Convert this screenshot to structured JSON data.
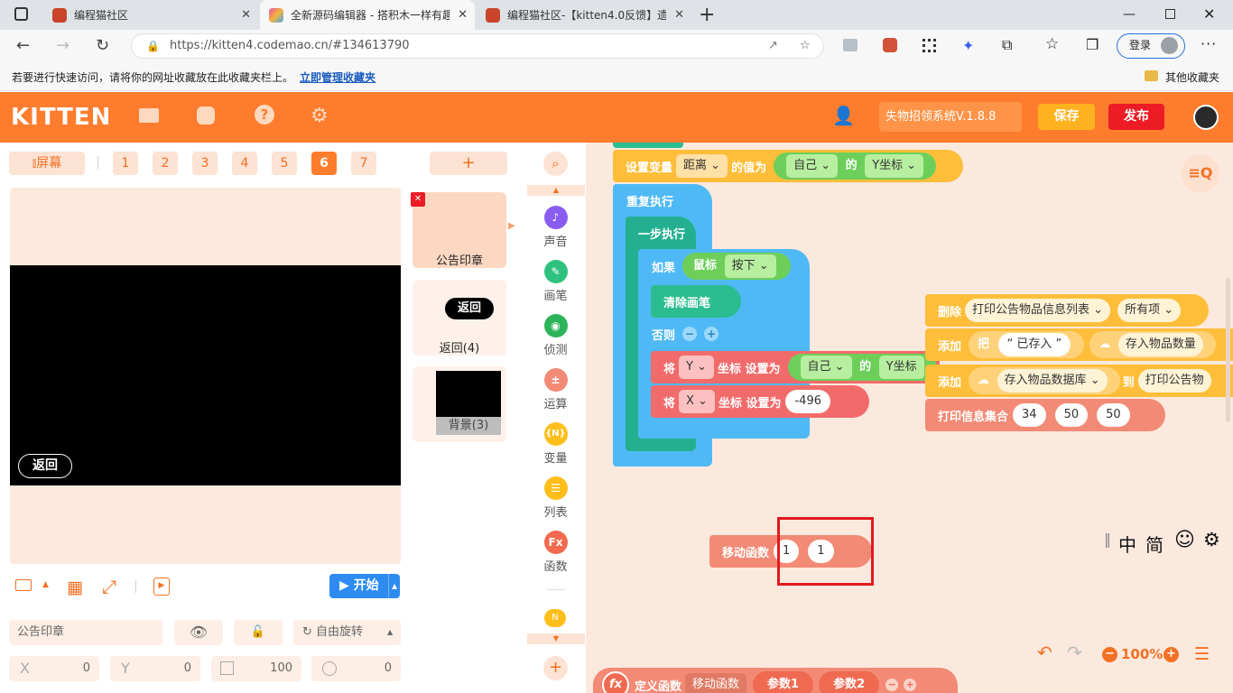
{
  "browser": {
    "tabs": [
      {
        "title": "编程猫社区",
        "active": false
      },
      {
        "title": "全新源码编辑器 - 搭积木一样有趣",
        "active": true
      },
      {
        "title": "编程猫社区-【kitten4.0反馈】遗",
        "active": false
      }
    ],
    "url": "https://kitten4.codemao.cn/#134613790",
    "login_label": "登录",
    "bookmark_tip": "若要进行快速访问，请将你的网址收藏放在此收藏夹栏上。",
    "bookmark_link": "立即管理收藏夹",
    "other_favorites": "其他收藏夹"
  },
  "app": {
    "logo": "KITTEN",
    "project_name": "失物招领系统V.1.8.8",
    "save_label": "保存",
    "publish_label": "发布",
    "accent": "#fe7c2d"
  },
  "screens": {
    "screen_toggle": "屏幕",
    "numbers": [
      "1",
      "2",
      "3",
      "4",
      "5",
      "6",
      "7"
    ],
    "active": "6"
  },
  "stage": {
    "back_label": "返回",
    "start_label": "开始"
  },
  "properties": {
    "name": "公告印章",
    "rotation": "自由旋转",
    "x_label": "X",
    "x_value": "0",
    "y_label": "Y",
    "y_value": "0",
    "size_value": "100",
    "direction_value": "0"
  },
  "sprites": {
    "add_label": "+",
    "items": [
      {
        "name": "公告印章"
      },
      {
        "name": "返回(4)",
        "thumb_text": "返回"
      },
      {
        "name": "背景(3)"
      }
    ]
  },
  "categories": [
    {
      "label": "声音",
      "color": "#8a5cf0",
      "icon": "music-icon"
    },
    {
      "label": "画笔",
      "color": "#2ec27e",
      "icon": "pen-icon"
    },
    {
      "label": "侦测",
      "color": "#2db35a",
      "icon": "sensing-icon"
    },
    {
      "label": "运算",
      "color": "#f38a75",
      "icon": "operator-icon"
    },
    {
      "label": "变量",
      "color": "#ffbe1a",
      "icon": "variable-icon",
      "glyph": "{N}"
    },
    {
      "label": "列表",
      "color": "#ffbe1a",
      "icon": "list-icon"
    },
    {
      "label": "函数",
      "color": "#f2694f",
      "icon": "function-icon",
      "glyph": "Fx"
    }
  ],
  "blocks": {
    "set_var": {
      "label": "设置变量",
      "var": "距离",
      "mid": "的值为",
      "obj": "自己",
      "of": "的",
      "attr": "Y坐标"
    },
    "repeat": "重复执行",
    "step": "一步执行",
    "if": {
      "label": "如果",
      "sensor": "鼠标",
      "state": "按下"
    },
    "clear": "清除画笔",
    "else": "否则",
    "set_y": {
      "label": "将",
      "axis": "Y",
      "mid": "坐标 设置为",
      "obj": "自己",
      "of": "的",
      "attr": "Y坐标"
    },
    "set_x": {
      "label": "将",
      "axis": "X",
      "mid": "坐标 设置为",
      "value": "-496"
    },
    "delete": {
      "label": "删除",
      "list": "打印公告物品信息列表",
      "which": "所有项"
    },
    "add1": {
      "label": "添加",
      "verb": "把",
      "text": "“ 已存入 ”",
      "cloud": "存入物品数量"
    },
    "add2": {
      "label": "添加",
      "cloud": "存入物品数据库",
      "to": "到",
      "list": "打印公告物"
    },
    "print": {
      "label": "打印信息集合",
      "a": "34",
      "b": "50",
      "c": "50"
    },
    "move_fn": {
      "label": "移动函数",
      "a": "1",
      "b": "1"
    },
    "define": {
      "label": "定义函数",
      "name": "移动函数",
      "p1": "参数1",
      "p2": "参数2"
    }
  },
  "workspace": {
    "ime": [
      "中",
      "简"
    ],
    "zoom": "100%"
  }
}
